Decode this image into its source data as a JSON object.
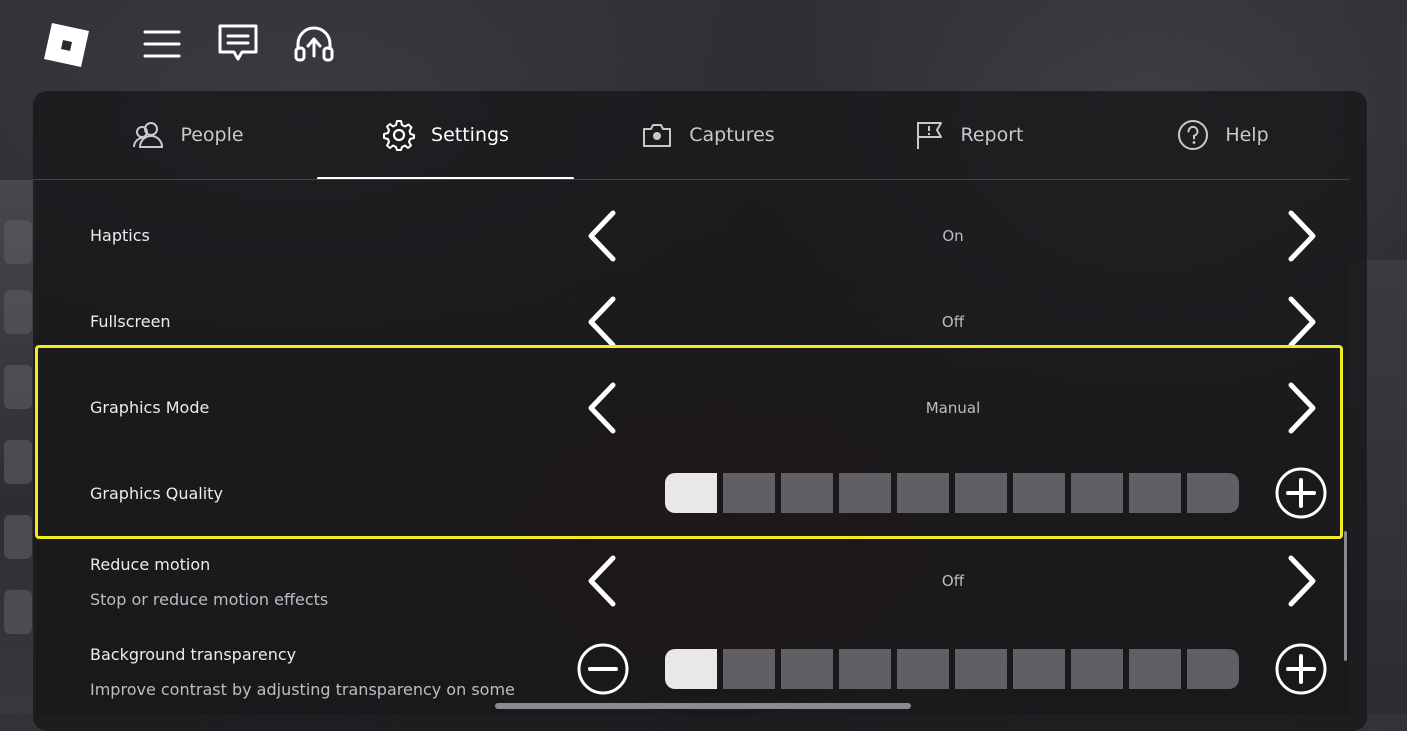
{
  "tabs": [
    {
      "label": "People",
      "icon": "people-icon"
    },
    {
      "label": "Settings",
      "icon": "gear-icon"
    },
    {
      "label": "Captures",
      "icon": "camera-icon"
    },
    {
      "label": "Report",
      "icon": "flag-icon"
    },
    {
      "label": "Help",
      "icon": "help-icon"
    }
  ],
  "active_tab": "Settings",
  "settings": {
    "haptics": {
      "label": "Haptics",
      "value": "On"
    },
    "fullscreen": {
      "label": "Fullscreen",
      "value": "Off"
    },
    "graphics_mode": {
      "label": "Graphics Mode",
      "value": "Manual"
    },
    "graphics_quality": {
      "label": "Graphics Quality",
      "level": 1,
      "max": 10
    },
    "reduce_motion": {
      "label": "Reduce motion",
      "description": "Stop or reduce motion effects",
      "value": "Off"
    },
    "background_transparency": {
      "label": "Background transparency",
      "description": "Improve contrast by adjusting transparency on some",
      "level": 1,
      "max": 10
    }
  },
  "colors": {
    "highlight": "#f3ec1c",
    "accent": "#ffffff",
    "panel": "#18181b"
  }
}
